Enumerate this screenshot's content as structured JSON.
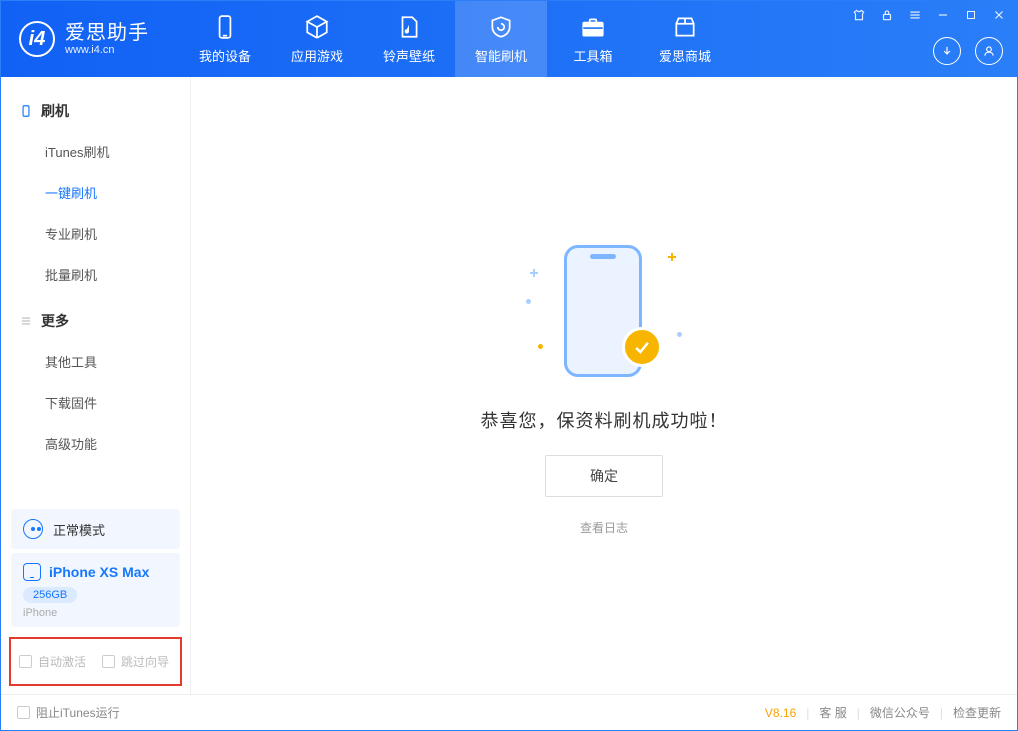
{
  "app": {
    "title": "爱思助手",
    "subtitle": "www.i4.cn"
  },
  "nav": {
    "tabs": [
      {
        "label": "我的设备"
      },
      {
        "label": "应用游戏"
      },
      {
        "label": "铃声壁纸"
      },
      {
        "label": "智能刷机"
      },
      {
        "label": "工具箱"
      },
      {
        "label": "爱思商城"
      }
    ]
  },
  "sidebar": {
    "sections": [
      {
        "title": "刷机",
        "items": [
          {
            "label": "iTunes刷机"
          },
          {
            "label": "一键刷机"
          },
          {
            "label": "专业刷机"
          },
          {
            "label": "批量刷机"
          }
        ]
      },
      {
        "title": "更多",
        "items": [
          {
            "label": "其他工具"
          },
          {
            "label": "下载固件"
          },
          {
            "label": "高级功能"
          }
        ]
      }
    ],
    "mode": "正常模式",
    "device": {
      "name": "iPhone XS Max",
      "capacity": "256GB",
      "type": "iPhone"
    },
    "options": {
      "auto_activate": "自动激活",
      "skip_guide": "跳过向导"
    }
  },
  "main": {
    "success_text": "恭喜您，保资料刷机成功啦！",
    "ok_button": "确定",
    "view_log": "查看日志"
  },
  "statusbar": {
    "block_itunes": "阻止iTunes运行",
    "version": "V8.16",
    "support": "客 服",
    "wechat": "微信公众号",
    "update": "检查更新"
  }
}
